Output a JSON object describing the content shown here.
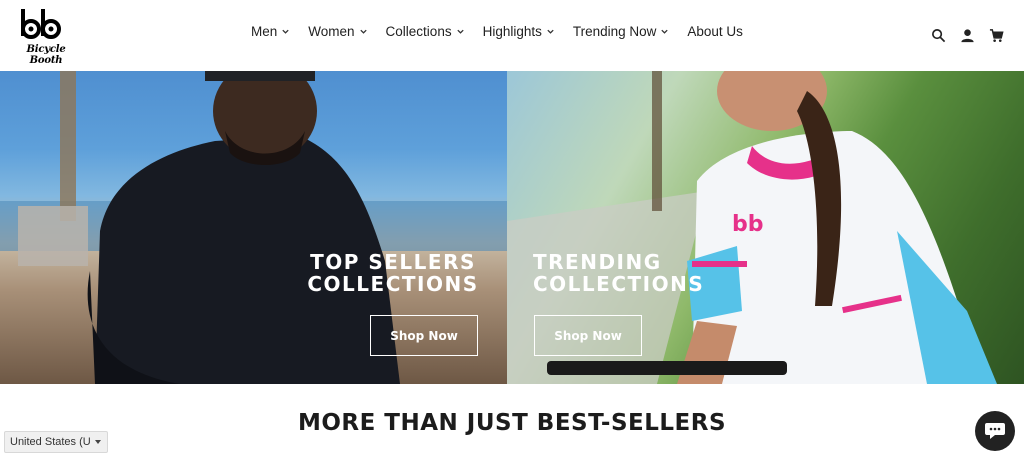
{
  "header": {
    "logo_text": "Bicycle Booth",
    "nav": [
      {
        "label": "Men",
        "has_dropdown": true
      },
      {
        "label": "Women",
        "has_dropdown": true
      },
      {
        "label": "Collections",
        "has_dropdown": true
      },
      {
        "label": "Highlights",
        "has_dropdown": true
      },
      {
        "label": "Trending Now",
        "has_dropdown": true
      },
      {
        "label": "About Us",
        "has_dropdown": false
      }
    ],
    "icons": [
      "search-icon",
      "account-icon",
      "cart-icon"
    ]
  },
  "hero": {
    "left": {
      "title_line1": "TOP SELLERS",
      "title_line2": "COLLECTIONS",
      "button": "Shop Now"
    },
    "right": {
      "title_line1": "TRENDING",
      "title_line2": "COLLECTIONS",
      "button": "Shop Now"
    }
  },
  "section": {
    "title": "MORE THAN JUST BEST-SELLERS"
  },
  "country_selector": {
    "value": "United States (U"
  },
  "chat": {
    "icon": "chat-icon"
  },
  "colors": {
    "text": "#1f1f1f",
    "chat_bg": "#222222",
    "accent_pink": "#e6318a"
  }
}
